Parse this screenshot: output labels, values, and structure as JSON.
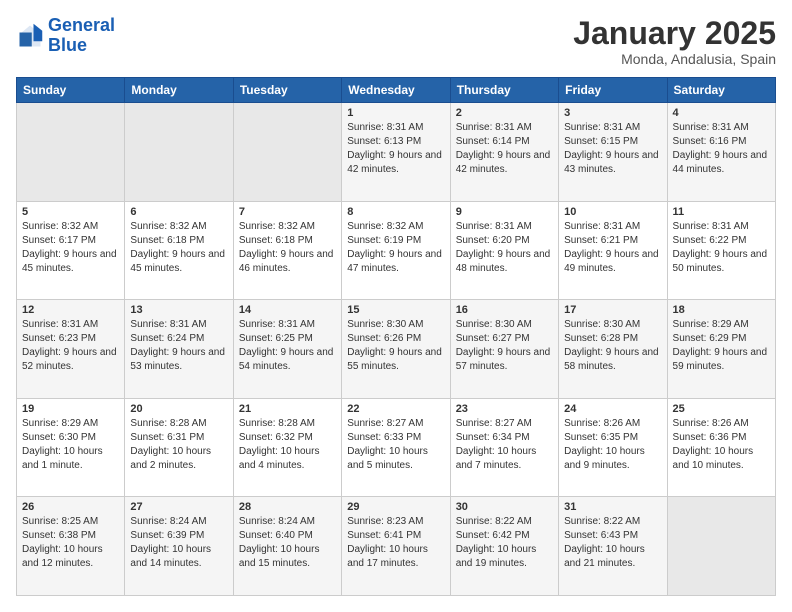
{
  "header": {
    "logo_line1": "General",
    "logo_line2": "Blue",
    "title": "January 2025",
    "subtitle": "Monda, Andalusia, Spain"
  },
  "days_of_week": [
    "Sunday",
    "Monday",
    "Tuesday",
    "Wednesday",
    "Thursday",
    "Friday",
    "Saturday"
  ],
  "weeks": [
    [
      {
        "day": "",
        "info": ""
      },
      {
        "day": "",
        "info": ""
      },
      {
        "day": "",
        "info": ""
      },
      {
        "day": "1",
        "info": "Sunrise: 8:31 AM\nSunset: 6:13 PM\nDaylight: 9 hours\nand 42 minutes."
      },
      {
        "day": "2",
        "info": "Sunrise: 8:31 AM\nSunset: 6:14 PM\nDaylight: 9 hours\nand 42 minutes."
      },
      {
        "day": "3",
        "info": "Sunrise: 8:31 AM\nSunset: 6:15 PM\nDaylight: 9 hours\nand 43 minutes."
      },
      {
        "day": "4",
        "info": "Sunrise: 8:31 AM\nSunset: 6:16 PM\nDaylight: 9 hours\nand 44 minutes."
      }
    ],
    [
      {
        "day": "5",
        "info": "Sunrise: 8:32 AM\nSunset: 6:17 PM\nDaylight: 9 hours\nand 45 minutes."
      },
      {
        "day": "6",
        "info": "Sunrise: 8:32 AM\nSunset: 6:18 PM\nDaylight: 9 hours\nand 45 minutes."
      },
      {
        "day": "7",
        "info": "Sunrise: 8:32 AM\nSunset: 6:18 PM\nDaylight: 9 hours\nand 46 minutes."
      },
      {
        "day": "8",
        "info": "Sunrise: 8:32 AM\nSunset: 6:19 PM\nDaylight: 9 hours\nand 47 minutes."
      },
      {
        "day": "9",
        "info": "Sunrise: 8:31 AM\nSunset: 6:20 PM\nDaylight: 9 hours\nand 48 minutes."
      },
      {
        "day": "10",
        "info": "Sunrise: 8:31 AM\nSunset: 6:21 PM\nDaylight: 9 hours\nand 49 minutes."
      },
      {
        "day": "11",
        "info": "Sunrise: 8:31 AM\nSunset: 6:22 PM\nDaylight: 9 hours\nand 50 minutes."
      }
    ],
    [
      {
        "day": "12",
        "info": "Sunrise: 8:31 AM\nSunset: 6:23 PM\nDaylight: 9 hours\nand 52 minutes."
      },
      {
        "day": "13",
        "info": "Sunrise: 8:31 AM\nSunset: 6:24 PM\nDaylight: 9 hours\nand 53 minutes."
      },
      {
        "day": "14",
        "info": "Sunrise: 8:31 AM\nSunset: 6:25 PM\nDaylight: 9 hours\nand 54 minutes."
      },
      {
        "day": "15",
        "info": "Sunrise: 8:30 AM\nSunset: 6:26 PM\nDaylight: 9 hours\nand 55 minutes."
      },
      {
        "day": "16",
        "info": "Sunrise: 8:30 AM\nSunset: 6:27 PM\nDaylight: 9 hours\nand 57 minutes."
      },
      {
        "day": "17",
        "info": "Sunrise: 8:30 AM\nSunset: 6:28 PM\nDaylight: 9 hours\nand 58 minutes."
      },
      {
        "day": "18",
        "info": "Sunrise: 8:29 AM\nSunset: 6:29 PM\nDaylight: 9 hours\nand 59 minutes."
      }
    ],
    [
      {
        "day": "19",
        "info": "Sunrise: 8:29 AM\nSunset: 6:30 PM\nDaylight: 10 hours\nand 1 minute."
      },
      {
        "day": "20",
        "info": "Sunrise: 8:28 AM\nSunset: 6:31 PM\nDaylight: 10 hours\nand 2 minutes."
      },
      {
        "day": "21",
        "info": "Sunrise: 8:28 AM\nSunset: 6:32 PM\nDaylight: 10 hours\nand 4 minutes."
      },
      {
        "day": "22",
        "info": "Sunrise: 8:27 AM\nSunset: 6:33 PM\nDaylight: 10 hours\nand 5 minutes."
      },
      {
        "day": "23",
        "info": "Sunrise: 8:27 AM\nSunset: 6:34 PM\nDaylight: 10 hours\nand 7 minutes."
      },
      {
        "day": "24",
        "info": "Sunrise: 8:26 AM\nSunset: 6:35 PM\nDaylight: 10 hours\nand 9 minutes."
      },
      {
        "day": "25",
        "info": "Sunrise: 8:26 AM\nSunset: 6:36 PM\nDaylight: 10 hours\nand 10 minutes."
      }
    ],
    [
      {
        "day": "26",
        "info": "Sunrise: 8:25 AM\nSunset: 6:38 PM\nDaylight: 10 hours\nand 12 minutes."
      },
      {
        "day": "27",
        "info": "Sunrise: 8:24 AM\nSunset: 6:39 PM\nDaylight: 10 hours\nand 14 minutes."
      },
      {
        "day": "28",
        "info": "Sunrise: 8:24 AM\nSunset: 6:40 PM\nDaylight: 10 hours\nand 15 minutes."
      },
      {
        "day": "29",
        "info": "Sunrise: 8:23 AM\nSunset: 6:41 PM\nDaylight: 10 hours\nand 17 minutes."
      },
      {
        "day": "30",
        "info": "Sunrise: 8:22 AM\nSunset: 6:42 PM\nDaylight: 10 hours\nand 19 minutes."
      },
      {
        "day": "31",
        "info": "Sunrise: 8:22 AM\nSunset: 6:43 PM\nDaylight: 10 hours\nand 21 minutes."
      },
      {
        "day": "",
        "info": ""
      }
    ]
  ]
}
